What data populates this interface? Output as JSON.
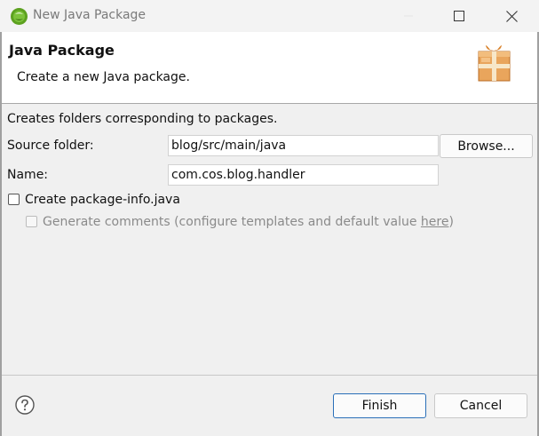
{
  "window": {
    "title": "New Java Package",
    "controls": {
      "minimize_icon": "minimize-icon",
      "maximize_icon": "maximize-icon",
      "close_icon": "close-icon"
    }
  },
  "header": {
    "title": "Java Package",
    "description": "Create a new Java package."
  },
  "form": {
    "intro": "Creates folders corresponding to packages.",
    "source_folder_label": "Source folder:",
    "source_folder_value": "blog/src/main/java",
    "browse_label": "Browse...",
    "name_label": "Name:",
    "name_value": "com.cos.blog.handler",
    "create_package_info_label": "Create package-info.java",
    "create_package_info_checked": false,
    "generate_comments_prefix": "Generate comments (configure templates and default value ",
    "generate_comments_link": "here",
    "generate_comments_suffix": ")",
    "generate_comments_checked": false,
    "generate_comments_enabled": false
  },
  "footer": {
    "finish_label": "Finish",
    "cancel_label": "Cancel"
  },
  "colors": {
    "default_button_border": "#2a6fb8",
    "icon_green": "#5ca11f",
    "package_orange": "#e39a4a"
  }
}
